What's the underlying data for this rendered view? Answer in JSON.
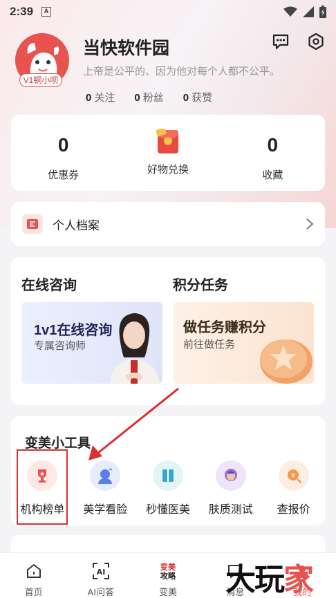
{
  "status_bar": {
    "time": "2:39",
    "notification": "A"
  },
  "profile": {
    "username": "当快软件园",
    "motto": "上帝是公平的、因为他对每个人都不公平。",
    "badge": "V1铜小呗",
    "stats": [
      {
        "value": "0",
        "label": "关注"
      },
      {
        "value": "0",
        "label": "粉丝"
      },
      {
        "value": "0",
        "label": "获赞"
      }
    ]
  },
  "summary": {
    "coupons": {
      "value": "0",
      "label": "优惠券"
    },
    "exchange": {
      "label": "好物兑换"
    },
    "favorites": {
      "value": "0",
      "label": "收藏"
    }
  },
  "archive": {
    "label": "个人档案"
  },
  "online_consult": {
    "title": "在线咨询",
    "banner_title": "1v1在线咨询",
    "banner_sub": "专属咨询师"
  },
  "points_task": {
    "title": "积分任务",
    "banner_title": "做任务赚积分",
    "banner_sub": "前往做任务"
  },
  "tools": {
    "title": "变美小工具",
    "items": [
      {
        "label": "机构榜单",
        "icon": "trophy-icon",
        "color": "#fde8e6"
      },
      {
        "label": "美学看脸",
        "icon": "face-scan-icon",
        "color": "#e6ecfb"
      },
      {
        "label": "秒懂医美",
        "icon": "book-icon",
        "color": "#e3f4f7"
      },
      {
        "label": "肤质测试",
        "icon": "skin-test-icon",
        "color": "#efe5fb"
      },
      {
        "label": "查报价",
        "icon": "price-search-icon",
        "color": "#fdeee2"
      }
    ]
  },
  "tabbar": [
    {
      "label": "首页",
      "icon": "home-icon",
      "active": false
    },
    {
      "label": "AI问答",
      "icon": "ai-icon",
      "active": false
    },
    {
      "label": "变美",
      "icon": "beauty-guide-icon",
      "active": false,
      "icon_text": "变美\n攻略"
    },
    {
      "label": "消息",
      "icon": "message-icon",
      "active": false
    },
    {
      "label": "我的",
      "icon": "profile-icon",
      "active": true
    }
  ],
  "watermark": {
    "text_a": "大玩",
    "text_b": "家"
  },
  "colors": {
    "accent": "#e8534f",
    "highlight": "#d93030"
  }
}
